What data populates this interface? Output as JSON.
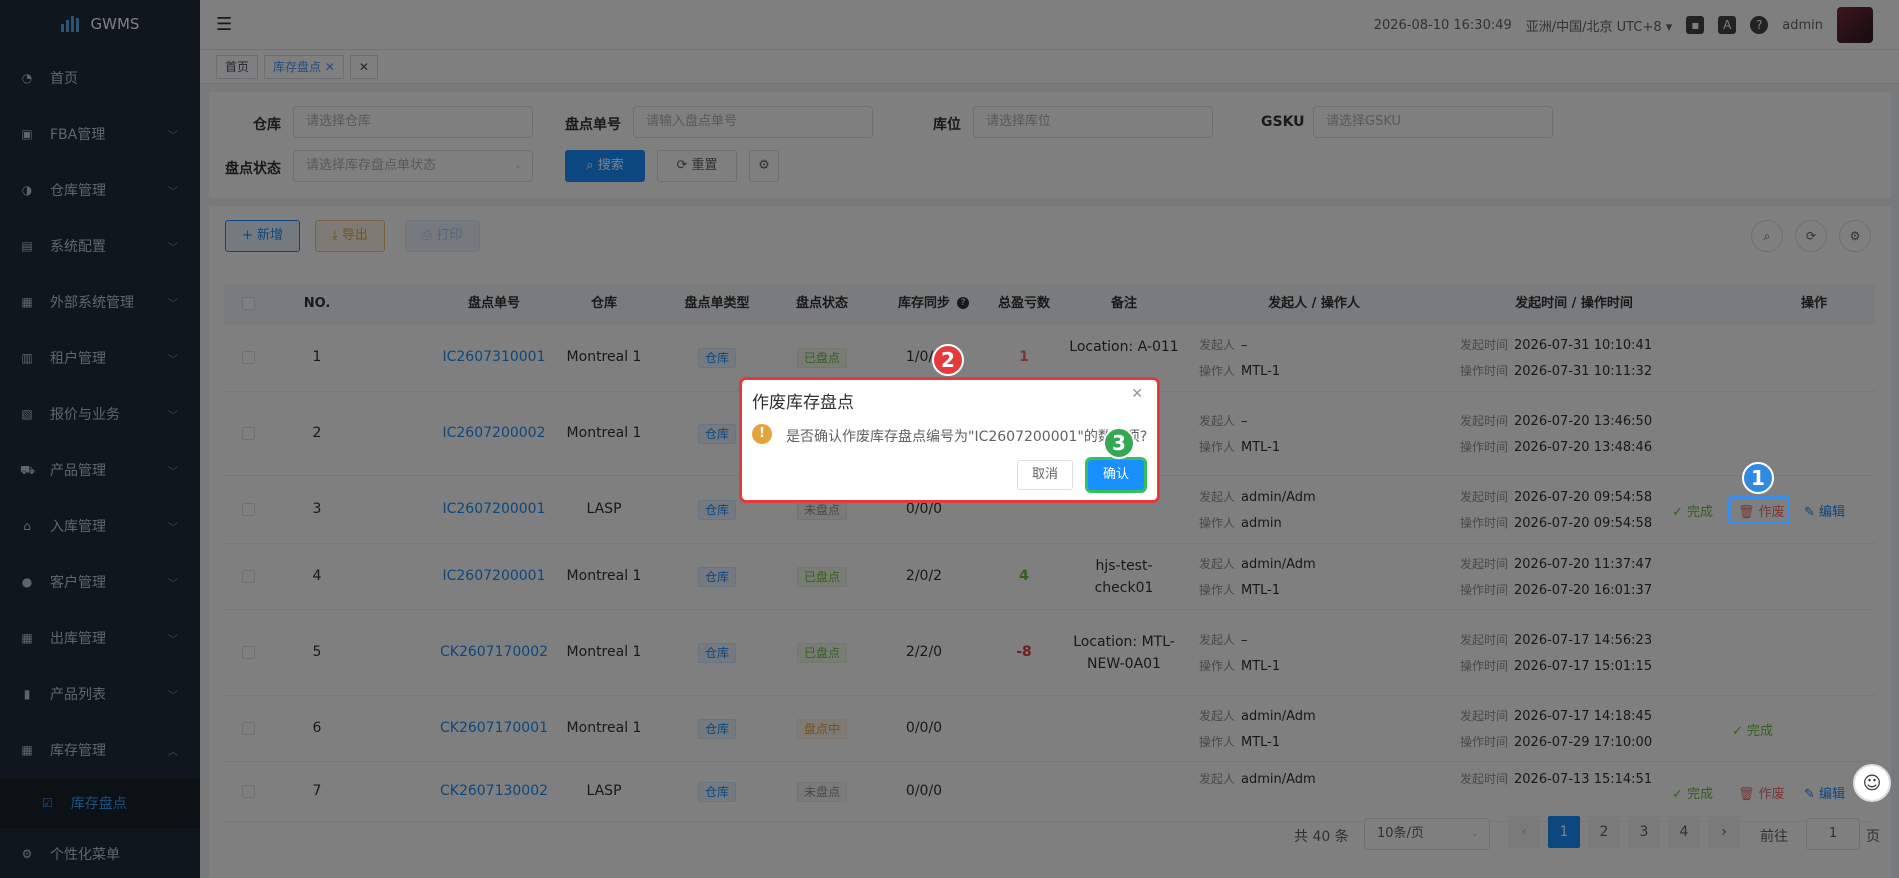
{
  "app": {
    "logo_text": "GWMS"
  },
  "sidebar": {
    "items": [
      {
        "label": "首页",
        "icon": "dashboard-icon"
      },
      {
        "label": "FBA管理",
        "icon": "fba-icon"
      },
      {
        "label": "仓库管理",
        "icon": "warehouse-icon"
      },
      {
        "label": "系统配置",
        "icon": "config-icon"
      },
      {
        "label": "外部系统管理",
        "icon": "grid-icon"
      },
      {
        "label": "租户管理",
        "icon": "bar-chart-icon"
      },
      {
        "label": "报价与业务",
        "icon": "quote-icon"
      },
      {
        "label": "产品管理",
        "icon": "cart-icon"
      },
      {
        "label": "入库管理",
        "icon": "home-icon"
      },
      {
        "label": "客户管理",
        "icon": "user-icon"
      },
      {
        "label": "出库管理",
        "icon": "grid-icon"
      },
      {
        "label": "产品列表",
        "icon": "book-icon"
      },
      {
        "label": "库存管理",
        "icon": "table-icon"
      }
    ],
    "active_sub": "库存盘点",
    "bottom_item": "个性化菜单"
  },
  "header": {
    "datetime": "2026-08-10 16:30:49",
    "timezone": "亚洲/中国/北京 UTC+8",
    "username": "admin"
  },
  "tags": {
    "home": "首页",
    "current": "库存盘点"
  },
  "search": {
    "warehouse_label": "仓库",
    "warehouse_placeholder": "请选择仓库",
    "order_label": "盘点单号",
    "order_placeholder": "请输入盘点单号",
    "location_label": "库位",
    "location_placeholder": "请选择库位",
    "gsku_label": "GSKU",
    "gsku_placeholder": "请选择GSKU",
    "status_label": "盘点状态",
    "status_placeholder": "请选择库存盘点单状态",
    "search_btn": "搜索",
    "reset_btn": "重置"
  },
  "toolbar": {
    "add": "新增",
    "export": "导出",
    "print": "打印"
  },
  "table": {
    "headers": [
      "NO.",
      "盘点单号",
      "仓库",
      "盘点单类型",
      "盘点状态",
      "库存同步",
      "总盈亏数",
      "备注",
      "发起人 / 操作人",
      "发起时间 / 操作时间",
      "操作"
    ],
    "initiator_label": "发起人",
    "operator_label": "操作人",
    "start_time_label": "发起时间",
    "op_time_label": "操作时间",
    "rows": [
      {
        "no": "1",
        "order": "IC2607310001",
        "warehouse": "Montreal 1",
        "type": "仓库",
        "status": "已盘点",
        "status_kind": "green",
        "sync": "1/0/1",
        "diff": "1",
        "diff_color": "#f56c6c",
        "remark": "Location: A-011",
        "initiator": "–",
        "operator": "MTL-1",
        "start_time": "2026-07-31 10:10:41",
        "op_time": "2026-07-31 10:11:32",
        "actions": []
      },
      {
        "no": "2",
        "order": "IC2607200002",
        "warehouse": "Montreal 1",
        "type": "仓库",
        "status": "",
        "status_kind": "",
        "sync": "",
        "diff": "",
        "diff_color": "#333333",
        "remark": "",
        "initiator": "–",
        "operator": "MTL-1",
        "start_time": "2026-07-20 13:46:50",
        "op_time": "2026-07-20 13:48:46",
        "actions": []
      },
      {
        "no": "3",
        "order": "IC2607200001",
        "warehouse": "LASP",
        "type": "仓库",
        "status": "未盘点",
        "status_kind": "gray",
        "sync": "0/0/0",
        "diff": "",
        "diff_color": "#333333",
        "remark": "",
        "initiator": "admin/Adm",
        "operator": "admin",
        "start_time": "2026-07-20 09:54:58",
        "op_time": "2026-07-20 09:54:58",
        "actions": [
          "完成",
          "作废",
          "编辑"
        ]
      },
      {
        "no": "4",
        "order": "IC2607200001",
        "warehouse": "Montreal 1",
        "type": "仓库",
        "status": "已盘点",
        "status_kind": "green",
        "sync": "2/0/2",
        "diff": "4",
        "diff_color": "#67c23a",
        "remark": "hjs-test-check01",
        "initiator": "admin/Adm",
        "operator": "MTL-1",
        "start_time": "2026-07-20 11:37:47",
        "op_time": "2026-07-20 16:01:37",
        "actions": []
      },
      {
        "no": "5",
        "order": "CK2607170002",
        "warehouse": "Montreal 1",
        "type": "仓库",
        "status": "已盘点",
        "status_kind": "green",
        "sync": "2/2/0",
        "diff": "-8",
        "diff_color": "#e03a3a",
        "remark": "Location: MTL-NEW-0A01",
        "initiator": "–",
        "operator": "MTL-1",
        "start_time": "2026-07-17 14:56:23",
        "op_time": "2026-07-17 15:01:15",
        "actions": []
      },
      {
        "no": "6",
        "order": "CK2607170001",
        "warehouse": "Montreal 1",
        "type": "仓库",
        "status": "盘点中",
        "status_kind": "orange",
        "sync": "0/0/0",
        "diff": "",
        "diff_color": "#333333",
        "remark": "",
        "initiator": "admin/Adm",
        "operator": "MTL-1",
        "start_time": "2026-07-17 14:18:45",
        "op_time": "2026-07-29 17:10:00",
        "actions": [
          "完成"
        ]
      },
      {
        "no": "7",
        "order": "CK2607130002",
        "warehouse": "LASP",
        "type": "仓库",
        "status": "未盘点",
        "status_kind": "gray",
        "sync": "0/0/0",
        "diff": "",
        "diff_color": "#333333",
        "remark": "",
        "initiator": "admin/Adm",
        "operator": "",
        "start_time": "2026-07-13 15:14:51",
        "op_time": "",
        "actions": [
          "完成",
          "作废",
          "编辑"
        ]
      }
    ]
  },
  "pagination": {
    "total": "共 40 条",
    "page_size": "10条/页",
    "pages": [
      "1",
      "2",
      "3",
      "4"
    ],
    "goto_label": "前往",
    "goto_value": "1",
    "page_suffix": "页"
  },
  "dialog": {
    "title": "作废库存盘点",
    "message": "是否确认作废库存盘点编号为\"IC2607200001\"的数据项?",
    "cancel": "取消",
    "confirm": "确认"
  },
  "steps": [
    "1",
    "2",
    "3"
  ],
  "colors": {
    "accent": "#1890ff",
    "sidebar_bg": "#1f2d3d",
    "step1": "#2f8ae0",
    "step2": "#e33b3b",
    "step3": "#34a853"
  }
}
